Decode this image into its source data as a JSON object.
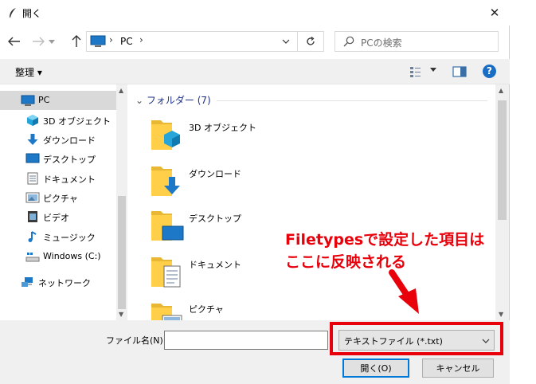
{
  "window": {
    "title": "開く",
    "close_glyph": "✕"
  },
  "address": {
    "location": "PC",
    "chevron": "›"
  },
  "search": {
    "placeholder": "PCの検索"
  },
  "toolbar": {
    "organize_label": "整理 ▾",
    "help_glyph": "?"
  },
  "nav": {
    "items": [
      {
        "label": "PC",
        "icon": "pc-icon",
        "selected": true
      },
      {
        "label": "3D オブジェクト",
        "icon": "3d-objects-icon"
      },
      {
        "label": "ダウンロード",
        "icon": "download-icon"
      },
      {
        "label": "デスクトップ",
        "icon": "desktop-icon"
      },
      {
        "label": "ドキュメント",
        "icon": "document-icon"
      },
      {
        "label": "ピクチャ",
        "icon": "picture-icon"
      },
      {
        "label": "ビデオ",
        "icon": "video-icon"
      },
      {
        "label": "ミュージック",
        "icon": "music-icon"
      },
      {
        "label": "Windows (C:)",
        "icon": "drive-icon"
      },
      {
        "label": "ネットワーク",
        "icon": "network-icon"
      }
    ]
  },
  "content": {
    "group_header": "フォルダー (7)",
    "folders": [
      {
        "label": "3D オブジェクト",
        "overlay": "3d-objects-icon"
      },
      {
        "label": "ダウンロード",
        "overlay": "download-icon"
      },
      {
        "label": "デスクトップ",
        "overlay": "desktop-icon"
      },
      {
        "label": "ドキュメント",
        "overlay": "document-icon"
      },
      {
        "label": "ピクチャ",
        "overlay": "picture-icon"
      }
    ]
  },
  "bottom": {
    "filename_label": "ファイル名(N):",
    "filename_value": "",
    "filetype_value": "テキストファイル (*.txt)",
    "open_label": "開く(O)",
    "cancel_label": "キャンセル"
  },
  "annotation": {
    "line1": "Filetypesで設定した項目は",
    "line2": "ここに反映される",
    "color": "#e8000b"
  },
  "colors": {
    "accent": "#0078d7",
    "annotation": "#e8000b",
    "folder": "#ffcf4a",
    "header_text": "#1e3287"
  }
}
